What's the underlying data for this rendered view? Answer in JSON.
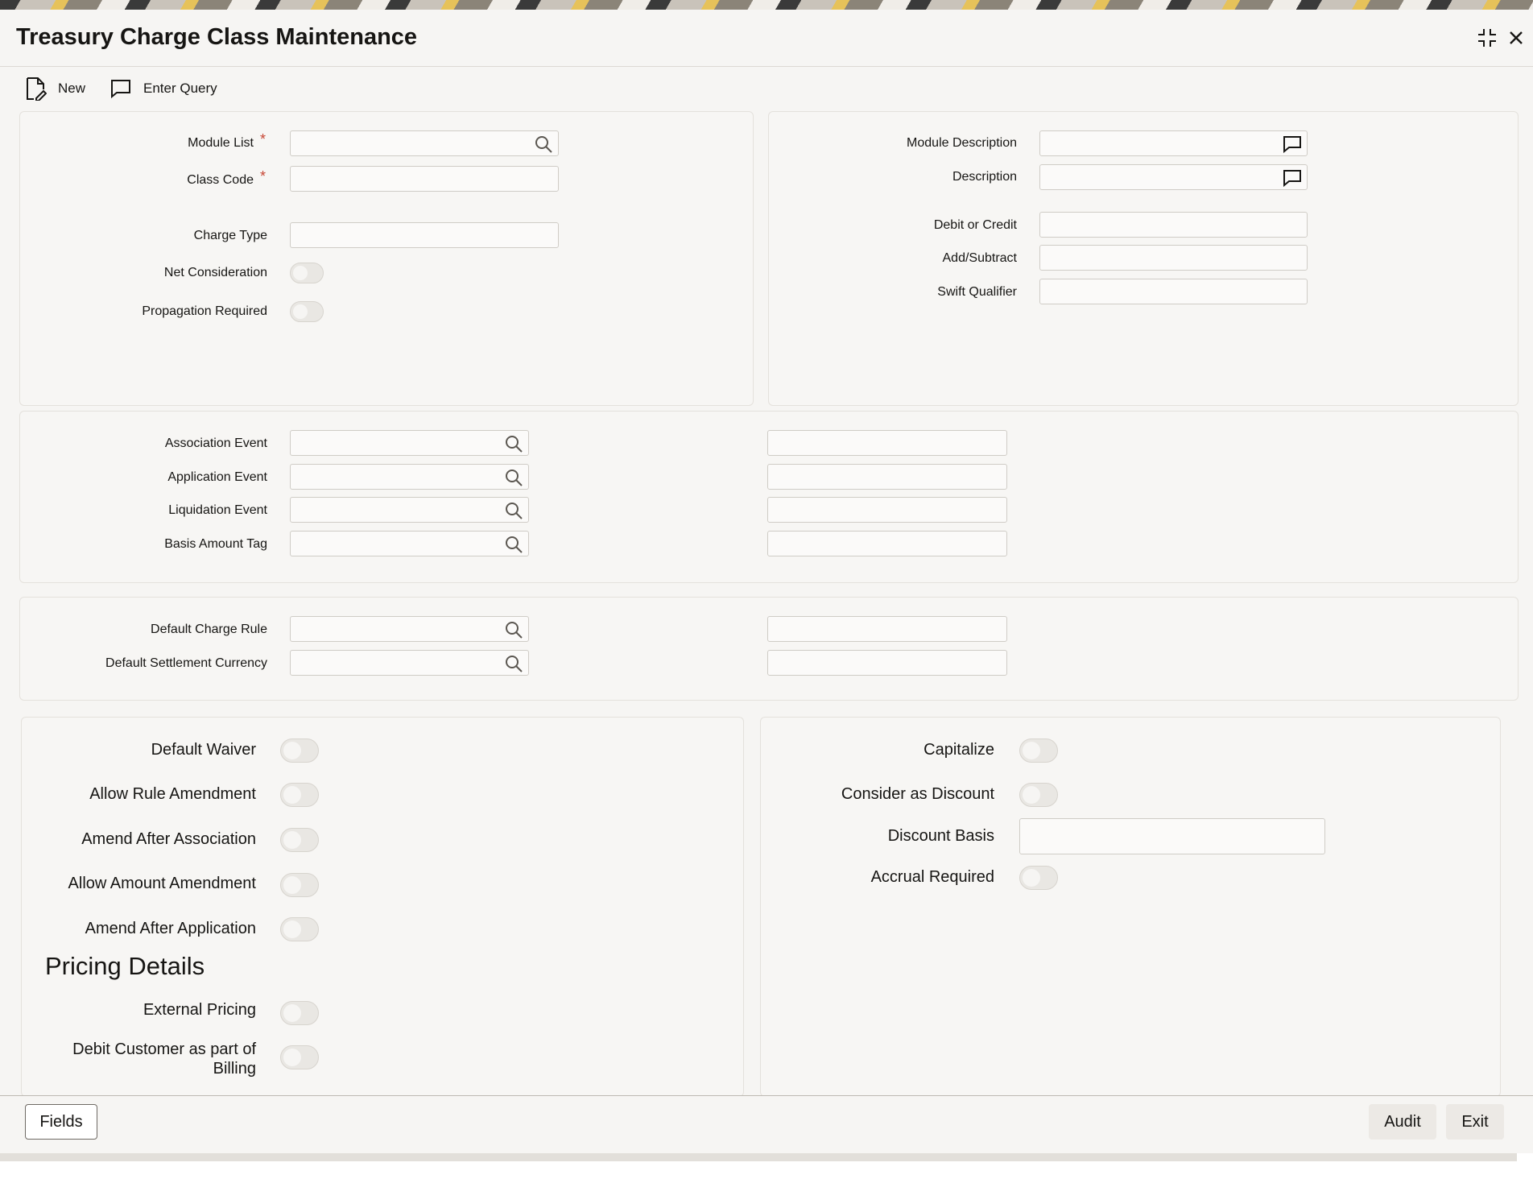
{
  "window": {
    "title": "Treasury Charge Class Maintenance"
  },
  "toolbar": {
    "new_label": "New",
    "enter_query_label": "Enter Query"
  },
  "main": {
    "module_list_label": "Module List",
    "class_code_label": "Class Code",
    "charge_type_label": "Charge Type",
    "net_consideration_label": "Net Consideration",
    "propagation_required_label": "Propagation Required",
    "required_mark": "*",
    "module_list_value": "",
    "class_code_value": "",
    "charge_type_value": ""
  },
  "side": {
    "module_description_label": "Module Description",
    "description_label": "Description",
    "debit_or_credit_label": "Debit or Credit",
    "add_subtract_label": "Add/Subtract",
    "swift_qualifier_label": "Swift Qualifier"
  },
  "events": {
    "association_event_label": "Association Event",
    "application_event_label": "Application Event",
    "liquidation_event_label": "Liquidation Event",
    "basis_amount_tag_label": "Basis Amount Tag"
  },
  "defaults": {
    "default_charge_rule_label": "Default Charge Rule",
    "default_settlement_currency_label": "Default Settlement Currency"
  },
  "options": {
    "default_waiver_label": "Default Waiver",
    "allow_rule_amendment_label": "Allow Rule Amendment",
    "amend_after_association_label": "Amend After Association",
    "allow_amount_amendment_label": "Allow Amount Amendment",
    "amend_after_application_label": "Amend After Application",
    "capitalize_label": "Capitalize",
    "consider_as_discount_label": "Consider as Discount",
    "discount_basis_label": "Discount Basis",
    "accrual_required_label": "Accrual Required"
  },
  "pricing": {
    "section_title": "Pricing Details",
    "external_pricing_label": "External Pricing",
    "debit_customer_line1": "Debit Customer as part of",
    "debit_customer_line2": "Billing"
  },
  "footer": {
    "fields_label": "Fields",
    "audit_label": "Audit",
    "exit_label": "Exit"
  },
  "icons": {
    "new": "new-document-icon",
    "enter_query": "chat-bubble-icon",
    "lookup": "search-icon",
    "description": "chat-bubble-icon",
    "minimize": "collapse-icon",
    "close": "close-icon"
  },
  "colors": {
    "required": "#c74634",
    "background": "#f6f5f3",
    "panel": "#f7f6f4"
  }
}
